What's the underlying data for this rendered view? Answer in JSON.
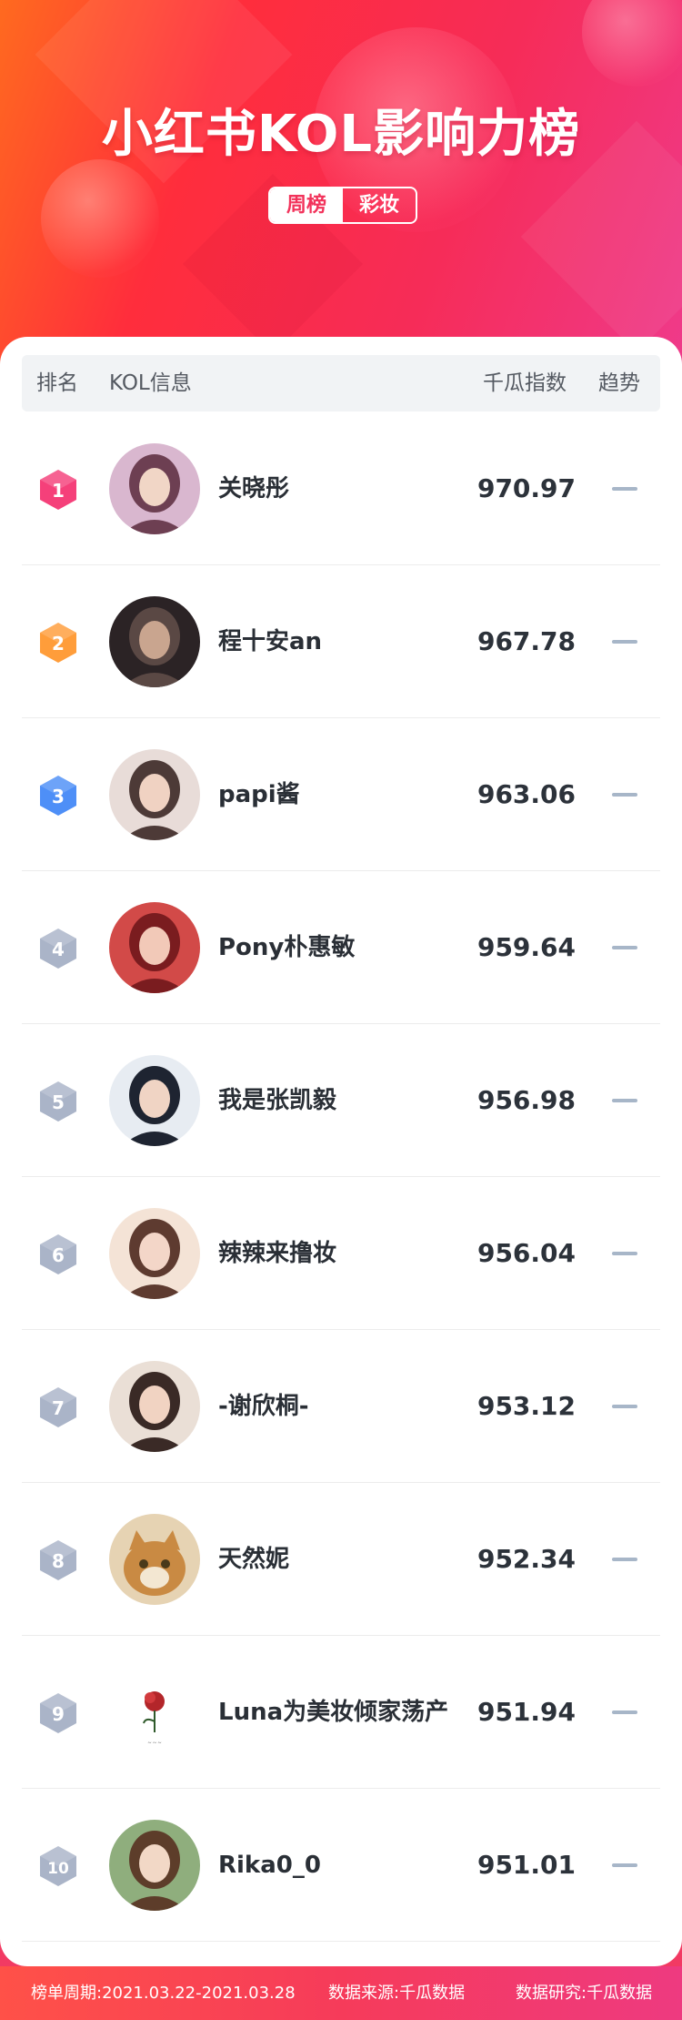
{
  "page": {
    "title": "小红书KOL影响力榜"
  },
  "tabs": [
    {
      "label": "周榜",
      "active": true
    },
    {
      "label": "彩妆",
      "active": false
    }
  ],
  "table": {
    "headers": {
      "rank": "排名",
      "info": "KOL信息",
      "index": "千瓜指数",
      "trend": "趋势"
    },
    "rows": [
      {
        "rank": "1",
        "name": "关晓彤",
        "score": "970.97",
        "trend": "flat",
        "badge_color": "#f5407a",
        "avatar_icon": "avatar-photo"
      },
      {
        "rank": "2",
        "name": "程十安an",
        "score": "967.78",
        "trend": "flat",
        "badge_color": "#ff9d3a",
        "avatar_icon": "avatar-photo"
      },
      {
        "rank": "3",
        "name": "papi酱",
        "score": "963.06",
        "trend": "flat",
        "badge_color": "#4e8ff7",
        "avatar_icon": "avatar-photo"
      },
      {
        "rank": "4",
        "name": "Pony朴惠敏",
        "score": "959.64",
        "trend": "flat",
        "badge_color": "#aab4c8",
        "avatar_icon": "avatar-photo"
      },
      {
        "rank": "5",
        "name": "我是张凯毅",
        "score": "956.98",
        "trend": "flat",
        "badge_color": "#aab4c8",
        "avatar_icon": "avatar-photo"
      },
      {
        "rank": "6",
        "name": "辣辣来撸妆",
        "score": "956.04",
        "trend": "flat",
        "badge_color": "#aab4c8",
        "avatar_icon": "avatar-photo"
      },
      {
        "rank": "7",
        "name": "-谢欣桐-",
        "score": "953.12",
        "trend": "flat",
        "badge_color": "#aab4c8",
        "avatar_icon": "avatar-photo"
      },
      {
        "rank": "8",
        "name": "天然妮",
        "score": "952.34",
        "trend": "flat",
        "badge_color": "#aab4c8",
        "avatar_icon": "cat-avatar-photo"
      },
      {
        "rank": "9",
        "name": "Luna为美妆倾家荡产",
        "score": "951.94",
        "trend": "flat",
        "badge_color": "#aab4c8",
        "avatar_icon": "rose-logo-avatar"
      },
      {
        "rank": "10",
        "name": "Rika0_0",
        "score": "951.01",
        "trend": "flat",
        "badge_color": "#aab4c8",
        "avatar_icon": "avatar-photo"
      }
    ]
  },
  "footer": {
    "period": "榜单周期:2021.03.22-2021.03.28",
    "source": "数据来源:千瓜数据",
    "research": "数据研究:千瓜数据"
  },
  "colors": {
    "accent": "#f2335b",
    "trend_flat": "#a7b6c8"
  }
}
